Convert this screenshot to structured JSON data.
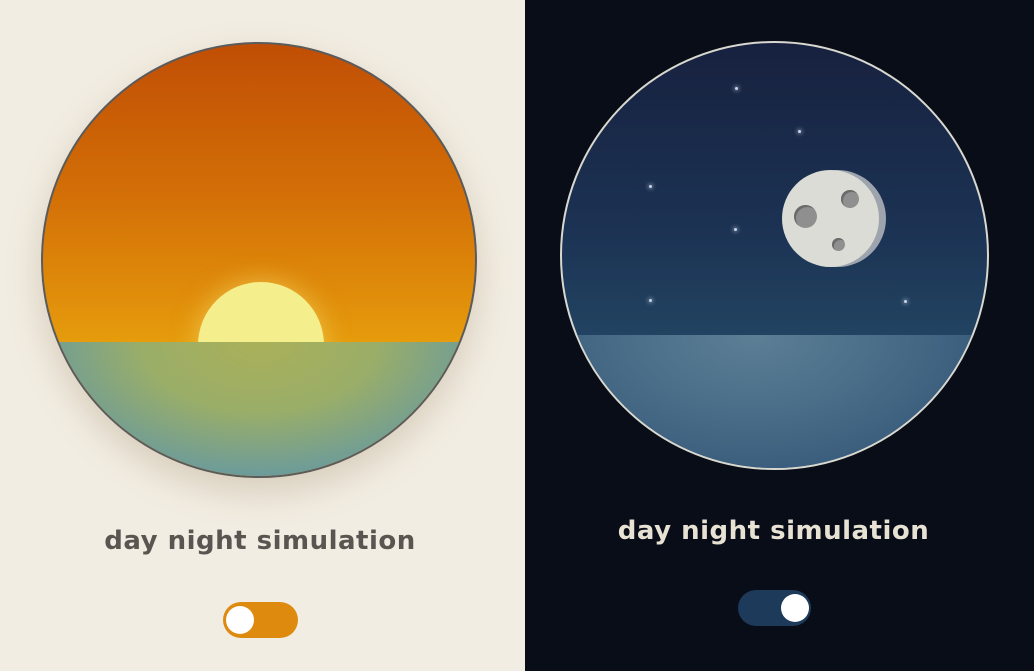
{
  "day": {
    "title": "day night simulation",
    "toggle_state": "off",
    "colors": {
      "background": "#f2ede3",
      "sky_top": "#c04e05",
      "sky_bottom": "#e8a40e",
      "sun": "#f4ee8c",
      "sea": "#9aae68",
      "toggle": "#de8a0f"
    }
  },
  "night": {
    "title": "day night simulation",
    "toggle_state": "on",
    "colors": {
      "background": "#080d17",
      "sky_top": "#17213f",
      "sky_bottom": "#224462",
      "moon": "#dcdcd6",
      "sea": "#4a6e88",
      "toggle": "#1e3a5a"
    }
  }
}
